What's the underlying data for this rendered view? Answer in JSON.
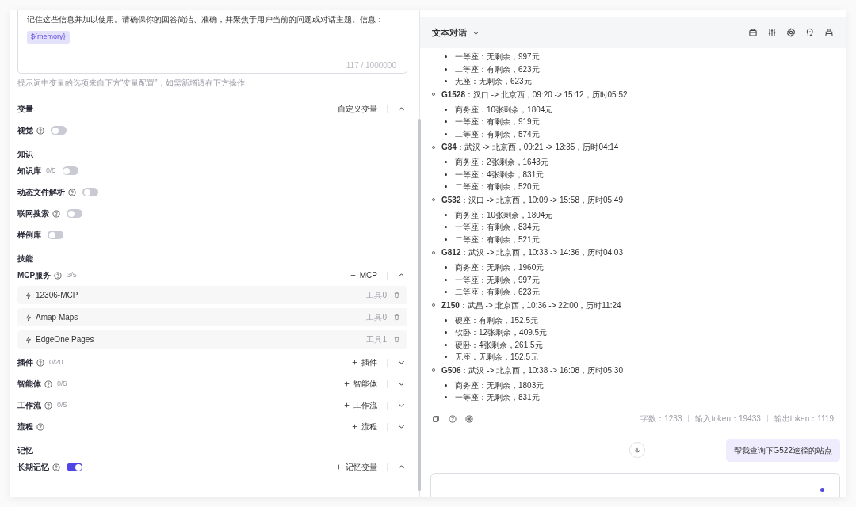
{
  "prompt": {
    "text": "记住这些信息并加以使用。请确保你的回答简洁、准确，并聚焦于用户当前的问题或对话主题。信息：",
    "variable": "${memory}",
    "counter": "117 / 1000000",
    "hint": "提示词中变量的选项来自下方“变量配置”，如需新增请在下方操作"
  },
  "settings": [
    {
      "kind": "group",
      "label": "变量",
      "action": "自定义变量",
      "expanded": true
    },
    {
      "kind": "toggle",
      "label": "视觉",
      "help": true,
      "on": false
    },
    {
      "kind": "heading",
      "label": "知识"
    },
    {
      "kind": "toggle",
      "label": "知识库",
      "count": "0/5",
      "on": false
    },
    {
      "kind": "toggle",
      "label": "动态文件解析",
      "help": true,
      "on": false
    },
    {
      "kind": "toggle",
      "label": "联网搜索",
      "help": true,
      "on": false
    },
    {
      "kind": "toggle",
      "label": "样例库",
      "on": false
    },
    {
      "kind": "heading",
      "label": "技能"
    },
    {
      "kind": "group",
      "label": "MCP服务",
      "help": true,
      "count": "3/5",
      "action": "MCP",
      "expanded": true,
      "items": [
        {
          "name": "12306-MCP",
          "tools": "工具0"
        },
        {
          "name": "Amap Maps",
          "tools": "工具0"
        },
        {
          "name": "EdgeOne Pages",
          "tools": "工具1"
        }
      ]
    },
    {
      "kind": "group",
      "label": "插件",
      "help": true,
      "count": "0/20",
      "action": "插件",
      "expanded": false
    },
    {
      "kind": "group",
      "label": "智能体",
      "help": true,
      "count": "0/5",
      "action": "智能体",
      "expanded": false
    },
    {
      "kind": "group",
      "label": "工作流",
      "help": true,
      "count": "0/5",
      "action": "工作流",
      "expanded": false
    },
    {
      "kind": "group",
      "label": "流程",
      "help": true,
      "action": "流程",
      "expanded": false
    },
    {
      "kind": "heading",
      "label": "记忆"
    },
    {
      "kind": "group",
      "label": "长期记忆",
      "help": true,
      "on": true,
      "action": "记忆变量",
      "expanded": true
    }
  ],
  "chat": {
    "title": "文本对话",
    "trains": [
      {
        "seats": [
          "一等座：无剩余，997元",
          "二等座：有剩余，623元",
          "无座：无剩余，623元"
        ]
      },
      {
        "code": "G1528",
        "detail": "：汉口 -> 北京西，09:20 -> 15:12，历时05:52",
        "seats": [
          "商务座：10张剩余，1804元",
          "一等座：有剩余，919元",
          "二等座：有剩余，574元"
        ]
      },
      {
        "code": "G84",
        "detail": "：武汉 -> 北京西，09:21 -> 13:35，历时04:14",
        "seats": [
          "商务座：2张剩余，1643元",
          "一等座：4张剩余，831元",
          "二等座：有剩余，520元"
        ]
      },
      {
        "code": "G532",
        "detail": "：汉口 -> 北京西，10:09 -> 15:58，历时05:49",
        "seats": [
          "商务座：10张剩余，1804元",
          "一等座：有剩余，834元",
          "二等座：有剩余，521元"
        ]
      },
      {
        "code": "G812",
        "detail": "：武汉 -> 北京西，10:33 -> 14:36，历时04:03",
        "seats": [
          "商务座：无剩余，1960元",
          "一等座：无剩余，997元",
          "二等座：有剩余，623元"
        ]
      },
      {
        "code": "Z150",
        "detail": "：武昌 -> 北京西，10:36 -> 22:00，历时11:24",
        "seats": [
          "硬座：有剩余，152.5元",
          "软卧：12张剩余，409.5元",
          "硬卧：4张剩余，261.5元",
          "无座：无剩余，152.5元"
        ]
      },
      {
        "code": "G506",
        "detail": "：武汉 -> 北京西，10:38 -> 16:08，历时05:30",
        "seats": [
          "商务座：无剩余，1803元",
          "一等座：无剩余，831元"
        ]
      }
    ],
    "stats": [
      "字数：1233",
      "输入token：19433",
      "输出token：1119"
    ],
    "user_message": "帮我查询下G522途径的站点"
  }
}
